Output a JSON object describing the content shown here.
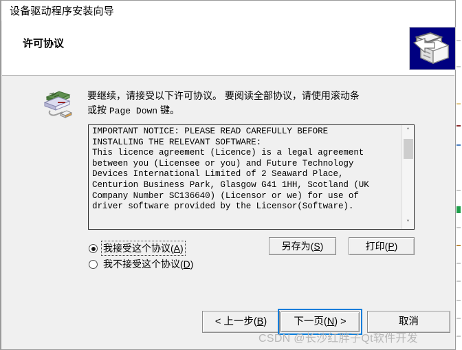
{
  "window": {
    "title": "设备驱动程序安装向导"
  },
  "header": {
    "title": "许可协议",
    "icon": "driver-wizard-icon"
  },
  "body": {
    "icon": "device-driver-icon",
    "instructions_line1": "要继续，请接受以下许可协议。 要阅读全部协议，请使用滚动条",
    "instructions_line2_pre": "或按 ",
    "instructions_line2_key": "Page Down",
    "instructions_line2_post": " 键。",
    "license_text": "IMPORTANT NOTICE: PLEASE READ CAREFULLY BEFORE\nINSTALLING THE RELEVANT SOFTWARE:\nThis licence agreement (Licence) is a legal agreement\nbetween you (Licensee or you) and Future Technology\nDevices International Limited of 2 Seaward Place,\nCenturion Business Park, Glasgow G41 1HH, Scotland (UK\nCompany Number SC136640) (Licensor or we) for use of\ndriver software provided by the Licensor(Software).",
    "scrollbar": {
      "up_arrow": "˄",
      "down_arrow": "˅"
    }
  },
  "radios": [
    {
      "label_pre": "我接受这个协议(",
      "accel": "A",
      "label_post": ")",
      "checked": true,
      "focused": true
    },
    {
      "label_pre": "我不接受这个协议(",
      "accel": "D",
      "label_post": ")",
      "checked": false,
      "focused": false
    }
  ],
  "side_buttons": {
    "save_as_pre": "另存为(",
    "save_as_accel": "S",
    "save_as_post": ")",
    "print_pre": "打印(",
    "print_accel": "P",
    "print_post": ")"
  },
  "nav_buttons": {
    "back_pre": "< 上一步(",
    "back_accel": "B",
    "back_post": ")",
    "next_pre": "下一页(",
    "next_accel": "N",
    "next_post": ") >",
    "cancel": "取消"
  },
  "watermark": "CSDN @长沙红胖子Qt软件开发",
  "colors": {
    "focus_border": "#0a7ddb",
    "header_icon_bg": "#000080",
    "dialog_bg": "#f0f0f0",
    "banner_bg": "#ffffff"
  }
}
